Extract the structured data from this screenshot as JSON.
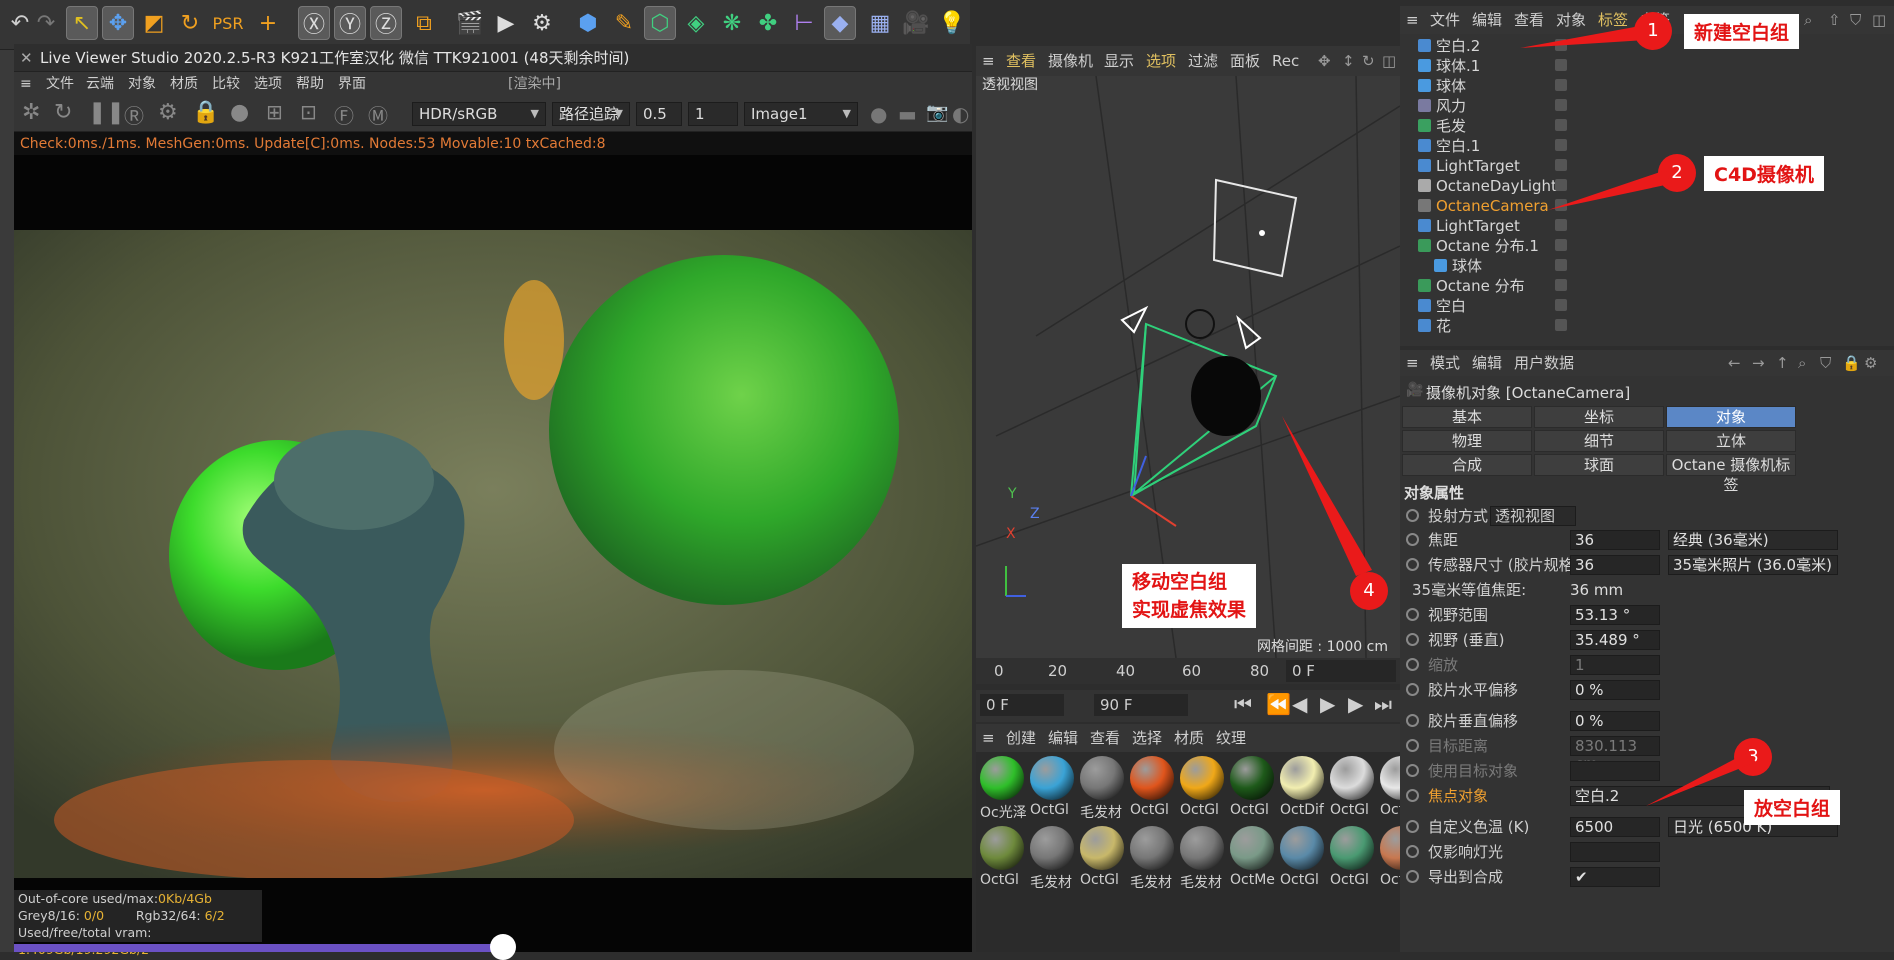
{
  "lv": {
    "title": "Live Viewer Studio 2020.2.5-R3  K921工作室汉化  微信  TTK921001  (48天剩余时间)",
    "menu": [
      "文件",
      "云端",
      "对象",
      "材质",
      "比较",
      "选项",
      "帮助",
      "界面"
    ],
    "render_state": "[渲染中]",
    "tonemap": "HDR/sRGB",
    "kernel": "路径追踪",
    "val1": "0.5",
    "val2": "1",
    "image": "Image1",
    "status": "Check:0ms./1ms. MeshGen:0ms. Update[C]:0ms. Nodes:53 Movable:10 txCached:8",
    "info1_label": "Out-of-core used/max:",
    "info1_val": "0Kb/4Gb",
    "info2_label": "Grey8/16:",
    "info2_val": "0/0",
    "info2b_label": "Rgb32/64:",
    "info2b_val": "6/2",
    "info3_label": "Used/free/total vram:",
    "info3_val": "1.409Gb/19.292Gb/2"
  },
  "vp": {
    "menu": [
      "查看",
      "摄像机",
      "显示",
      "选项",
      "过滤",
      "面板",
      "Rec"
    ],
    "title": "透视视图",
    "grid": "网格间距 : 1000 cm",
    "axis_y": "Y",
    "axis_z": "Z",
    "axis_x": "X",
    "timeline_ticks": [
      "0",
      "20",
      "40",
      "60",
      "80"
    ],
    "timeline_frame": "0 F",
    "start_frame": "0 F",
    "end_frame": "90 F"
  },
  "mat": {
    "menu": [
      "创建",
      "编辑",
      "查看",
      "选择",
      "材质",
      "纹理"
    ],
    "items": [
      {
        "label": "Oc光泽",
        "color": "#2fbf2a"
      },
      {
        "label": "OctGl",
        "color": "#3aa3d6"
      },
      {
        "label": "毛发材",
        "color": "#777"
      },
      {
        "label": "OctGl",
        "color": "#e0551c"
      },
      {
        "label": "OctGl",
        "color": "#f0a818"
      },
      {
        "label": "OctGl",
        "color": "#1e5a1a"
      },
      {
        "label": "OctDif",
        "color": "#f2eeb0"
      },
      {
        "label": "OctGl",
        "color": "#dcdcdc"
      },
      {
        "label": "OctGl",
        "color": "#e8e8e8"
      },
      {
        "label": "OctGl",
        "color": "#6e8a3c"
      },
      {
        "label": "毛发材",
        "color": "#777"
      },
      {
        "label": "OctGl",
        "color": "#c8b86a"
      },
      {
        "label": "毛发材",
        "color": "#777"
      },
      {
        "label": "毛发材",
        "color": "#777"
      },
      {
        "label": "OctMe",
        "color": "#7a9a88"
      },
      {
        "label": "OctGl",
        "color": "#5a8aa8"
      },
      {
        "label": "OctGl",
        "color": "#4a9a72"
      },
      {
        "label": "OctGl",
        "color": "#c87850"
      }
    ]
  },
  "om": {
    "menu": [
      "文件",
      "编辑",
      "查看",
      "对象",
      "标签",
      "书签"
    ],
    "rows": [
      {
        "name": "空白.2",
        "indent": 0,
        "color": "#4a8ad0"
      },
      {
        "name": "球体.1",
        "indent": 0,
        "color": "#4a9ae0"
      },
      {
        "name": "球体",
        "indent": 0,
        "color": "#4a9ae0"
      },
      {
        "name": "风力",
        "indent": 0,
        "color": "#7a7aa0"
      },
      {
        "name": "毛发",
        "indent": 0,
        "color": "#3aa060"
      },
      {
        "name": "空白.1",
        "indent": 0,
        "color": "#4a8ad0"
      },
      {
        "name": "LightTarget",
        "indent": 0,
        "color": "#4a8ad0"
      },
      {
        "name": "OctaneDayLight",
        "indent": 0,
        "color": "#aaaaaa"
      },
      {
        "name": "OctaneCamera",
        "indent": 0,
        "color": "#777",
        "selected": true
      },
      {
        "name": "LightTarget",
        "indent": 0,
        "color": "#4a8ad0"
      },
      {
        "name": "Octane 分布.1",
        "indent": 0,
        "color": "#3a9a5a"
      },
      {
        "name": "球体",
        "indent": 1,
        "color": "#4a9ae0"
      },
      {
        "name": "Octane 分布",
        "indent": 0,
        "color": "#3a9a5a"
      },
      {
        "name": "空白",
        "indent": 0,
        "color": "#4a8ad0"
      },
      {
        "name": "花",
        "indent": 0,
        "color": "#4a8ad0"
      }
    ]
  },
  "am": {
    "menu": [
      "模式",
      "编辑",
      "用户数据"
    ],
    "title": "摄像机对象 [OctaneCamera]",
    "tabs": [
      "基本",
      "坐标",
      "对象",
      "物理",
      "细节",
      "立体",
      "合成",
      "球面",
      "Octane 摄像机标签"
    ],
    "section": "对象属性",
    "projection_label": "投射方式",
    "projection_val": "透视视图",
    "props": [
      {
        "label": "焦距",
        "val": "36",
        "drop": "经典 (36毫米)"
      },
      {
        "label": "传感器尺寸 (胶片规格)",
        "val": "36",
        "drop": "35毫米照片 (36.0毫米)"
      },
      {
        "label": "35毫米等值焦距:",
        "val": "36 mm",
        "plain": true
      },
      {
        "label": "视野范围",
        "val": "53.13 °"
      },
      {
        "label": "视野 (垂直)",
        "val": "35.489 °"
      },
      {
        "label": "缩放",
        "val": "1",
        "dim": true
      },
      {
        "label": "胶片水平偏移",
        "val": "0 %"
      },
      {
        "label": "胶片垂直偏移",
        "val": "0 %"
      },
      {
        "label": "目标距离",
        "val": "830.113 cm",
        "dim": true
      },
      {
        "label": "使用目标对象",
        "val": "",
        "dim": true
      },
      {
        "label": "焦点对象",
        "val": "空白.2",
        "orange": true
      },
      {
        "label": "自定义色温 (K)",
        "val": "6500",
        "drop": "日光 (6500 K)"
      },
      {
        "label": "仅影响灯光",
        "val": ""
      },
      {
        "label": "导出到合成",
        "val": "✔"
      }
    ]
  },
  "callouts": {
    "c1": "新建空白组",
    "c2": "C4D摄像机",
    "c3": "放空白组",
    "c4a": "移动空白组",
    "c4b": "实现虚焦效果",
    "n1": "1",
    "n2": "2",
    "n3": "3",
    "n4": "4"
  }
}
